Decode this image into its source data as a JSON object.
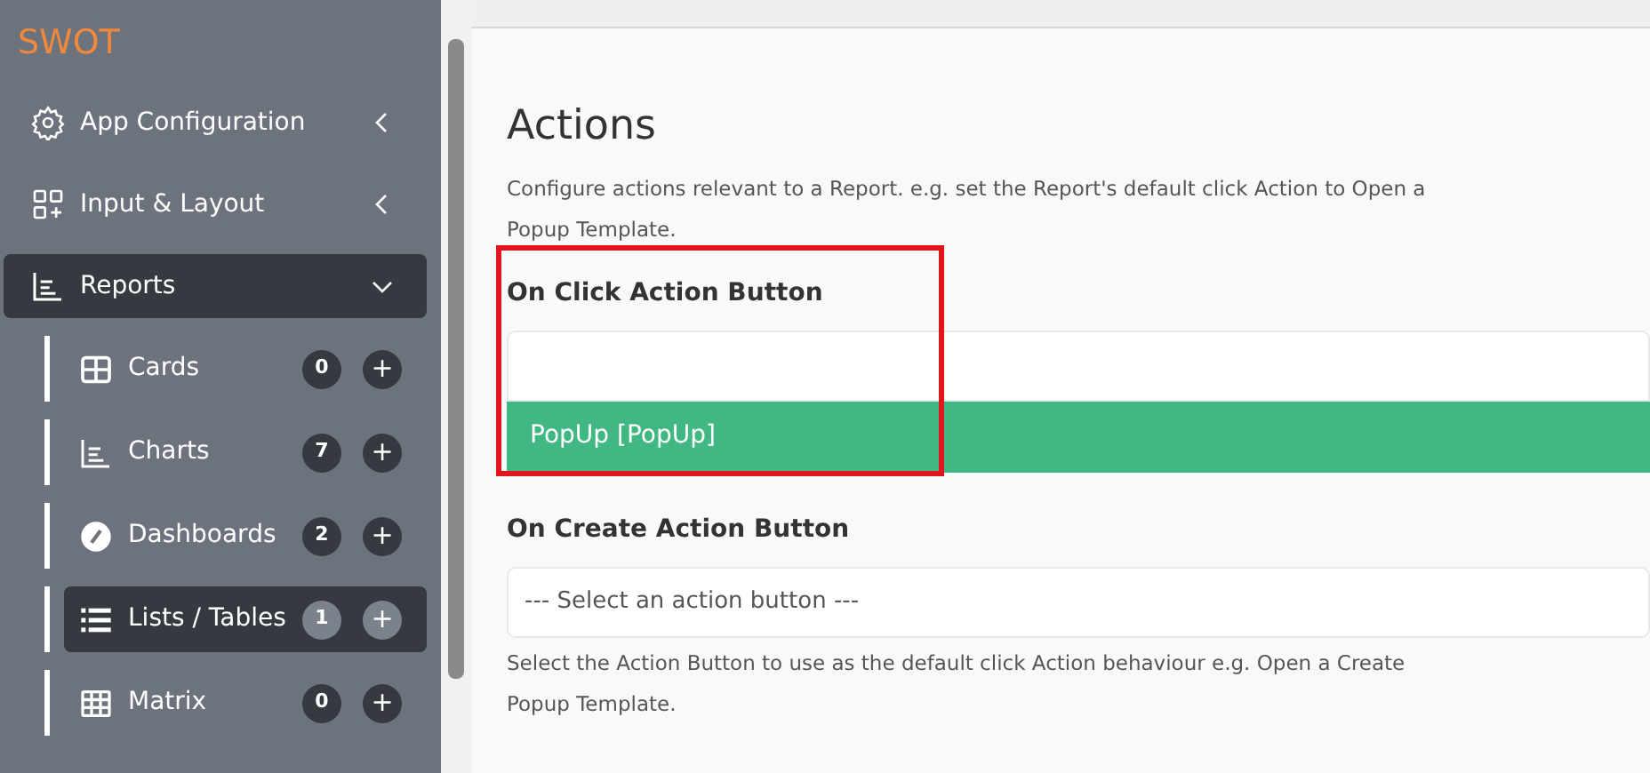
{
  "sidebar": {
    "brand": "SWOT",
    "items": [
      {
        "label": "App Configuration",
        "kind": "gear",
        "expanded": false,
        "selected": false
      },
      {
        "label": "Input & Layout",
        "kind": "grid-plus",
        "expanded": false,
        "selected": false
      },
      {
        "label": "Reports",
        "kind": "chart",
        "expanded": true,
        "selected": true,
        "children": [
          {
            "label": "Cards",
            "kind": "cards",
            "count": "0",
            "add": "+",
            "selected": false
          },
          {
            "label": "Charts",
            "kind": "chart",
            "count": "7",
            "add": "+",
            "selected": false
          },
          {
            "label": "Dashboards",
            "kind": "gauge",
            "count": "2",
            "add": "+",
            "selected": false
          },
          {
            "label": "Lists / Tables",
            "kind": "list",
            "count": "1",
            "add": "+",
            "selected": true
          },
          {
            "label": "Matrix",
            "kind": "matrix",
            "count": "0",
            "add": "+",
            "selected": false
          }
        ]
      }
    ]
  },
  "main": {
    "title": "Actions",
    "description": "Configure actions relevant to a Report. e.g. set the Report's default click Action to Open a Popup Template.",
    "fields": [
      {
        "label": "On Click Action Button",
        "open": true,
        "options": [
          {
            "label": "PopUp [PopUp]",
            "selected": true
          }
        ],
        "highlighted": true
      },
      {
        "label": "On Create Action Button",
        "value": "--- Select an action button ---",
        "open": false,
        "help": "Select the Action Button to use as the default click Action behaviour e.g. Open a Create Popup Template.",
        "highlighted": false
      }
    ]
  }
}
